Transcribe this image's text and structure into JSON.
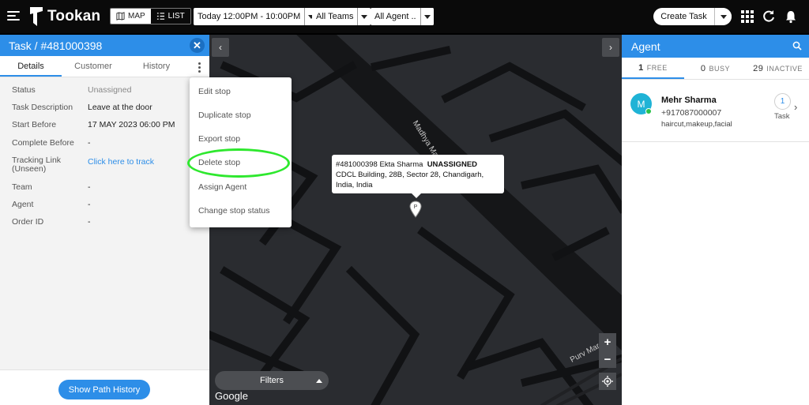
{
  "topbar": {
    "logo_text": "Tookan",
    "view_toggle": {
      "map_label": "MAP",
      "list_label": "LIST",
      "active": "map"
    },
    "date_filter": "Today 12:00PM - 10:00PM",
    "team_filter": "All Teams",
    "agent_filter": "All Agent ..",
    "create_task_label": "Create Task",
    "icons": [
      "menu-icon",
      "grid-apps-icon",
      "refresh-icon",
      "bell-icon"
    ]
  },
  "task_panel": {
    "title": "Task / #481000398",
    "tabs": [
      "Details",
      "Customer",
      "History"
    ],
    "active_tab": "Details",
    "fields": [
      {
        "label": "Status",
        "value": "Unassigned"
      },
      {
        "label": "Task Description",
        "value": "Leave at the door"
      },
      {
        "label": "Start Before",
        "value": "17 MAY 2023 06:00 PM"
      },
      {
        "label": "Complete Before",
        "value": "-"
      },
      {
        "label": "Tracking Link",
        "label2": "(Unseen)",
        "value": "Click here to track"
      },
      {
        "label": "Team",
        "value": "-"
      },
      {
        "label": "Agent",
        "value": "-"
      },
      {
        "label": "Order ID",
        "value": "-"
      }
    ],
    "footer_button": "Show Path History"
  },
  "context_menu": {
    "items": [
      "Edit stop",
      "Duplicate stop",
      "Export stop",
      "Delete stop",
      "Assign Agent",
      "Change stop status"
    ],
    "highlighted": "Delete stop",
    "highlight_color": "#2ee82e"
  },
  "map": {
    "road_labels": [
      "Madhya Marg",
      "Purv Marg"
    ],
    "tooltip": {
      "task_id": "#481000398",
      "customer": "Ekta Sharma",
      "status": "UNASSIGNED",
      "address_line1": "CDCL Building, 28B, Sector 28, Chandigarh,",
      "address_line2": "India, India"
    },
    "pin_letter": "P",
    "filters_label": "Filters",
    "attribution": "Google",
    "zoom_in": "+",
    "zoom_out": "−",
    "nav_prev": "‹",
    "nav_next": "›"
  },
  "agent_panel": {
    "title": "Agent",
    "stats": [
      {
        "count": "1",
        "label": "FREE"
      },
      {
        "count": "0",
        "label": "BUSY"
      },
      {
        "count": "29",
        "label": "INACTIVE"
      }
    ],
    "active_stat": "FREE",
    "agents": [
      {
        "initial": "M",
        "name": "Mehr Sharma",
        "phone": "+917087000007",
        "skills": "haircut,makeup,facial",
        "task_count": "1",
        "task_label": "Task"
      }
    ]
  },
  "colors": {
    "brand_blue": "#2d8ee8",
    "topbar_bg": "#0a0a0a",
    "map_bg": "#2a2c30",
    "avatar_bg": "#1fb3d6",
    "online": "#29c24a"
  }
}
